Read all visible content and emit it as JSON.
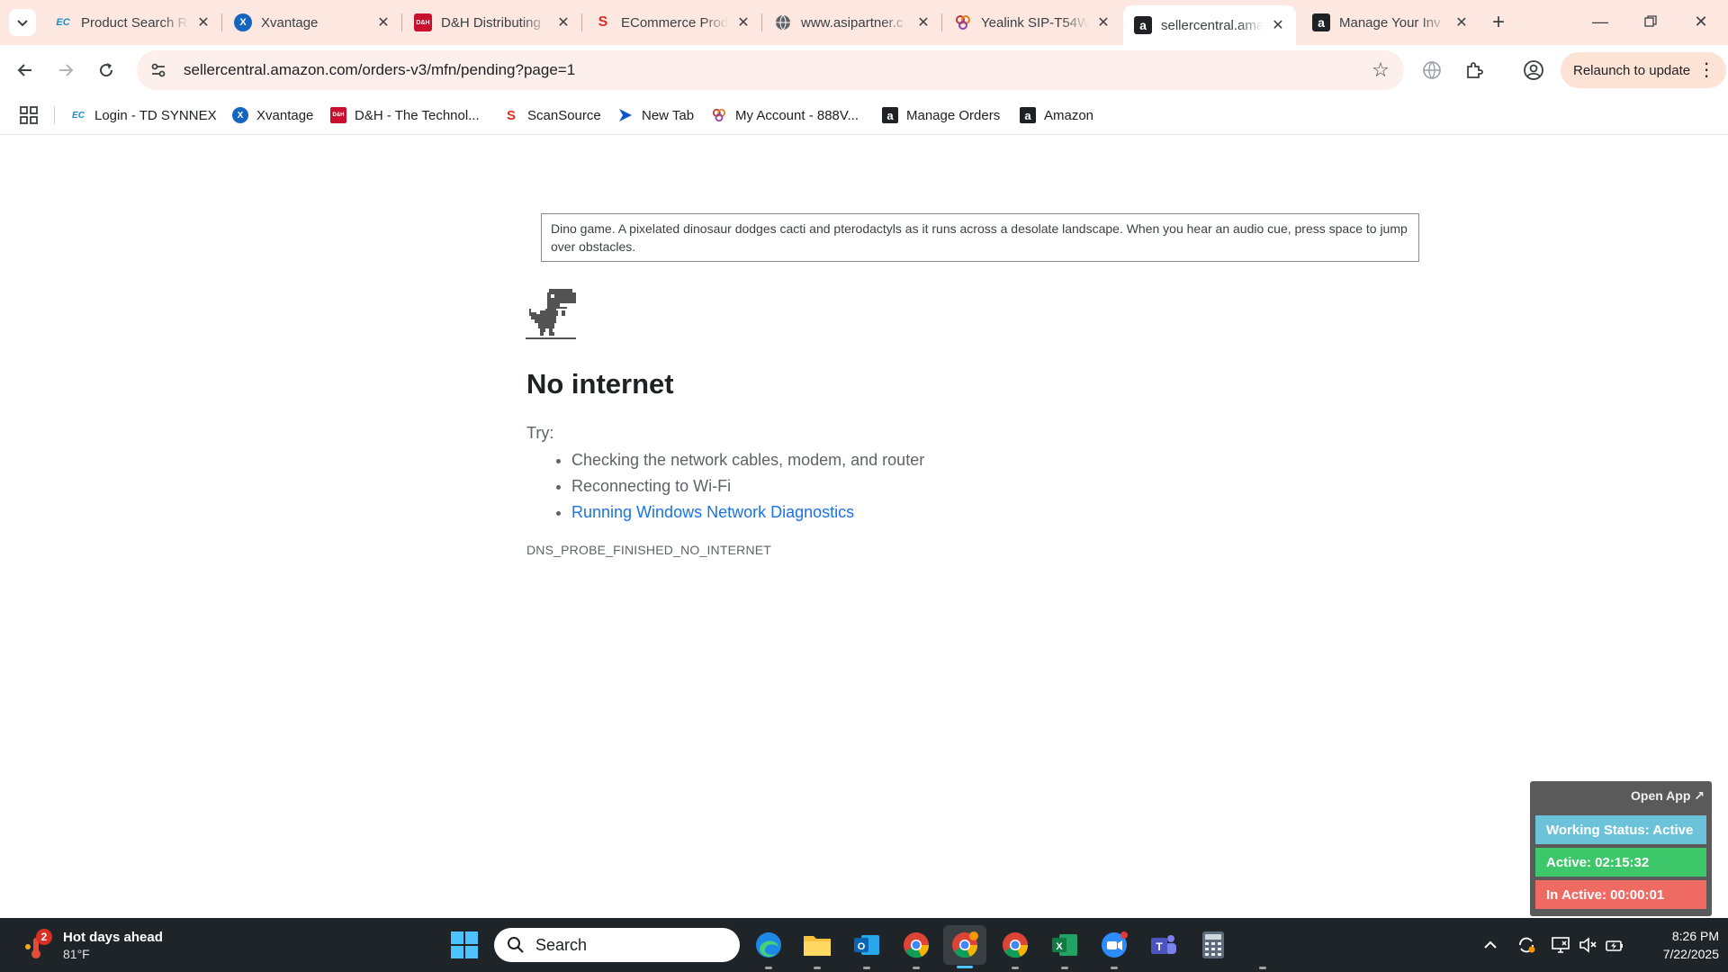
{
  "browser": {
    "tabs": [
      {
        "title": "Product Search R",
        "favicon_text": "EC",
        "favicon_color": "#1b8ec8"
      },
      {
        "title": "Xvantage",
        "favicon_text": "X",
        "favicon_color": "#1565c0"
      },
      {
        "title": "D&H Distributing",
        "favicon_text": "D&H",
        "favicon_color": "#c8102e"
      },
      {
        "title": "ECommerce Prod",
        "favicon_text": "S",
        "favicon_color": "#d93025"
      },
      {
        "title": "www.asipartner.c",
        "favicon_text": "",
        "favicon_color": "#5f6368"
      },
      {
        "title": "Yealink SIP-T54W",
        "favicon_text": "",
        "favicon_color": "#c0392b"
      },
      {
        "title": "sellercentral.ama",
        "favicon_text": "a",
        "favicon_color": "#202124"
      },
      {
        "title": "Manage Your Inv",
        "favicon_text": "a",
        "favicon_color": "#202124"
      }
    ],
    "active_tab_index": 6,
    "url": "sellercentral.amazon.com/orders-v3/mfn/pending?page=1",
    "relaunch_label": "Relaunch to update",
    "bookmarks": [
      {
        "label": "Login - TD SYNNEX",
        "icon_text": "EC",
        "icon_color": "#1b8ec8"
      },
      {
        "label": "Xvantage",
        "icon_text": "X",
        "icon_color": "#1565c0"
      },
      {
        "label": "D&H - The Technol...",
        "icon_text": "D&H",
        "icon_color": "#c8102e"
      },
      {
        "label": "ScanSource",
        "icon_text": "S",
        "icon_color": "#d93025"
      },
      {
        "label": "New Tab",
        "icon_text": "",
        "icon_color": "#0b57d0"
      },
      {
        "label": "My Account - 888V...",
        "icon_text": "",
        "icon_color": "#c0392b"
      },
      {
        "label": "Manage Orders",
        "icon_text": "a",
        "icon_color": "#202124"
      },
      {
        "label": "Amazon",
        "icon_text": "a",
        "icon_color": "#202124"
      }
    ]
  },
  "page": {
    "a11y_text": "Dino game. A pixelated dinosaur dodges cacti and pterodactyls as it runs across a desolate landscape. When you hear an audio cue, press space to jump over obstacles.",
    "title": "No internet",
    "try_label": "Try:",
    "suggestions": [
      "Checking the network cables, modem, and router",
      "Reconnecting to Wi-Fi"
    ],
    "diagnostics_link": "Running Windows Network Diagnostics",
    "error_code": "DNS_PROBE_FINISHED_NO_INTERNET"
  },
  "widget": {
    "open_app": "Open App ↗",
    "working_status": "Working Status: Active",
    "active": "Active: 02:15:32",
    "inactive": "In Active: 00:00:01",
    "colors": {
      "working": "#6cc3d9",
      "active": "#3ec66a",
      "inactive": "#ef6a63"
    }
  },
  "taskbar": {
    "weather_badge": "2",
    "weather_title": "Hot days ahead",
    "weather_temp": "81°F",
    "search_label": "Search",
    "time": "8:26 PM",
    "date": "7/22/2025"
  }
}
